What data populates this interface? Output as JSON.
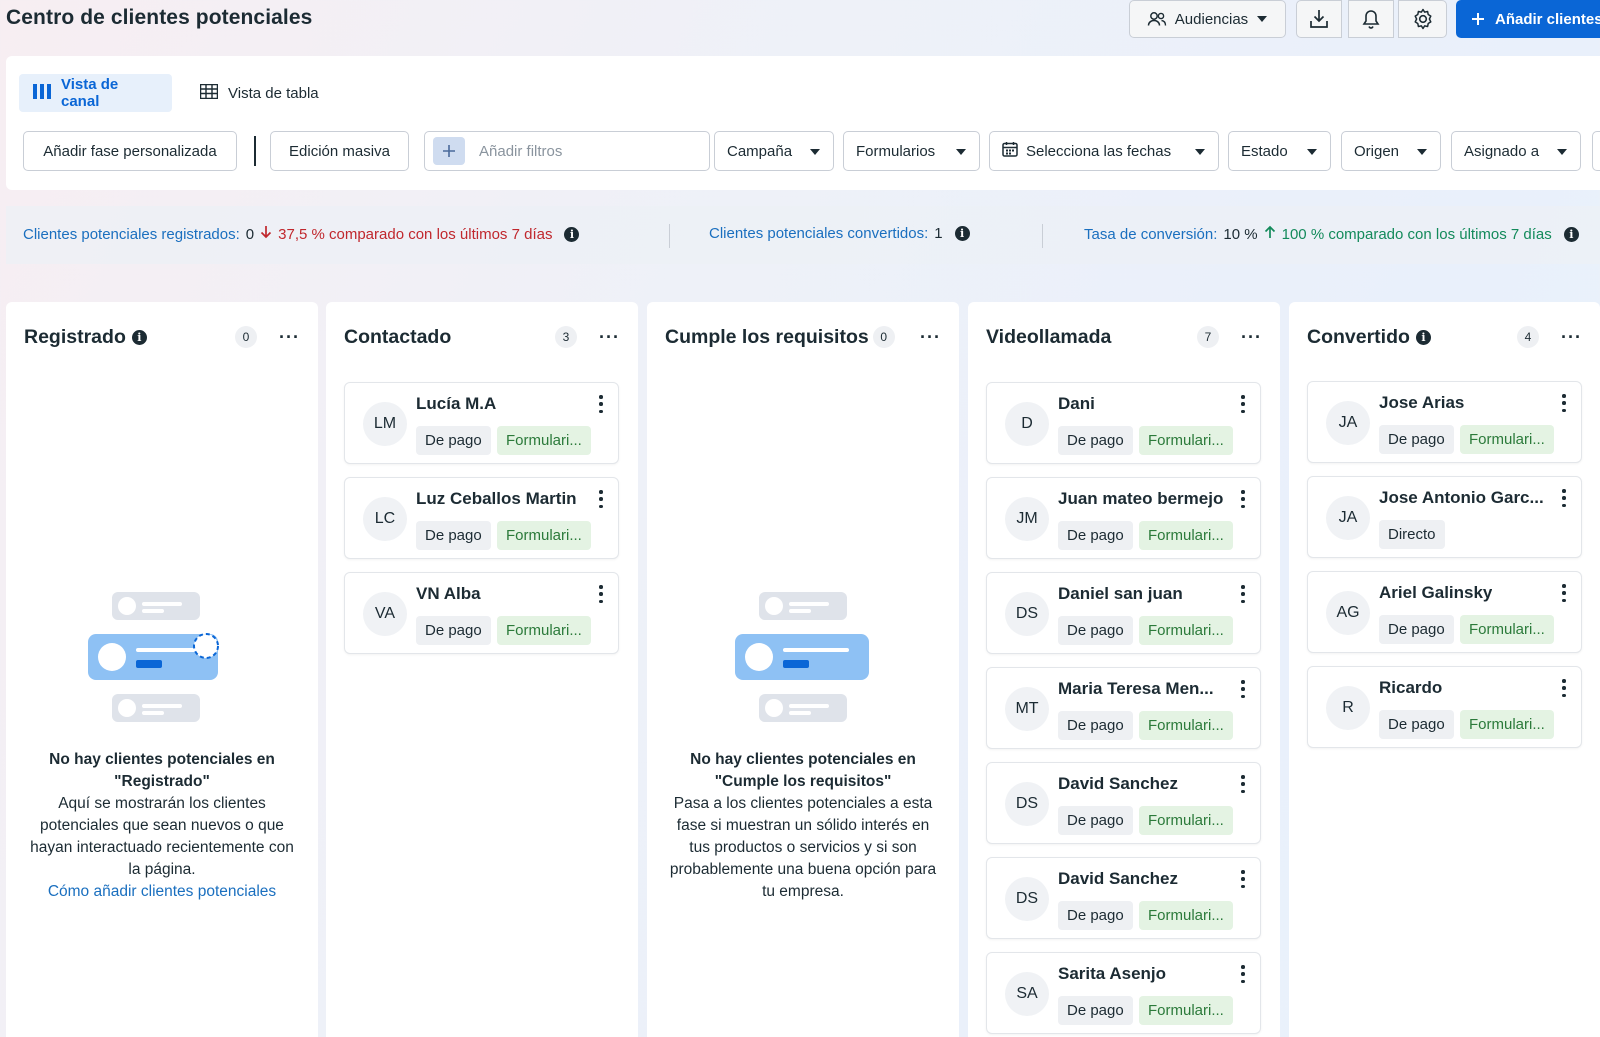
{
  "header": {
    "title": "Centro de clientes potenciales",
    "audiences_label": "Audiencias",
    "add_label": "Añadir clientes"
  },
  "views": {
    "pipeline_label": "Vista de canal",
    "table_label": "Vista de tabla"
  },
  "toolbar": {
    "custom_phase_label": "Añadir fase personalizada",
    "bulk_edit_label": "Edición masiva",
    "filter_placeholder": "Añadir filtros",
    "campaign_label": "Campaña",
    "forms_label": "Formularios",
    "dates_label": "Selecciona las fechas",
    "status_label": "Estado",
    "origin_label": "Origen",
    "assigned_label": "Asignado a"
  },
  "stats": {
    "registered_label": "Clientes potenciales registrados:",
    "registered_value": "0",
    "registered_change": "37,5 % comparado con los últimos 7 días",
    "converted_label": "Clientes potenciales convertidos:",
    "converted_value": "1",
    "rate_label": "Tasa de conversión:",
    "rate_value": "10 %",
    "rate_change": "100 % comparado con los últimos 7 días"
  },
  "columns": [
    {
      "title": "Registrado",
      "count": "0",
      "cards": [],
      "empty_title": "No hay clientes potenciales en \"Registrado\"",
      "empty_body": "Aquí se mostrarán los clientes potenciales que sean nuevos o que hayan interactuado recientemente con la página.",
      "empty_link": "Cómo añadir clientes potenciales"
    },
    {
      "title": "Contactado",
      "count": "3",
      "cards": [
        {
          "initials": "LM",
          "name": "Lucía M.A",
          "tag1": "De pago",
          "tag2": "Formulari..."
        },
        {
          "initials": "LC",
          "name": "Luz Ceballos Martin",
          "tag1": "De pago",
          "tag2": "Formulari..."
        },
        {
          "initials": "VA",
          "name": "VN Alba",
          "tag1": "De pago",
          "tag2": "Formulari..."
        }
      ]
    },
    {
      "title": "Cumple los requisitos",
      "count": "0",
      "cards": [],
      "empty_title": "No hay clientes potenciales en \"Cumple los requisitos\"",
      "empty_body": "Pasa a los clientes potenciales a esta fase si muestran un sólido interés en tus productos o servicios y si son probablemente una buena opción para tu empresa."
    },
    {
      "title": "Videollamada",
      "count": "7",
      "cards": [
        {
          "initials": "D",
          "name": "Dani",
          "tag1": "De pago",
          "tag2": "Formulari..."
        },
        {
          "initials": "JM",
          "name": "Juan mateo bermejo",
          "tag1": "De pago",
          "tag2": "Formulari..."
        },
        {
          "initials": "DS",
          "name": "Daniel san juan",
          "tag1": "De pago",
          "tag2": "Formulari..."
        },
        {
          "initials": "MT",
          "name": "Maria Teresa Men...",
          "tag1": "De pago",
          "tag2": "Formulari..."
        },
        {
          "initials": "DS",
          "name": "David Sanchez",
          "tag1": "De pago",
          "tag2": "Formulari..."
        },
        {
          "initials": "DS",
          "name": "David Sanchez",
          "tag1": "De pago",
          "tag2": "Formulari..."
        },
        {
          "initials": "SA",
          "name": "Sarita Asenjo",
          "tag1": "De pago",
          "tag2": "Formulari..."
        }
      ]
    },
    {
      "title": "Convertido",
      "count": "4",
      "cards": [
        {
          "initials": "JA",
          "name": "Jose Arias",
          "tag1": "De pago",
          "tag2": "Formulari..."
        },
        {
          "initials": "JA",
          "name": "Jose Antonio Garc...",
          "tag1": "Directo",
          "tag2": ""
        },
        {
          "initials": "AG",
          "name": "Ariel Galinsky",
          "tag1": "De pago",
          "tag2": "Formulari..."
        },
        {
          "initials": "R",
          "name": "Ricardo",
          "tag1": "De pago",
          "tag2": "Formulari..."
        }
      ]
    }
  ]
}
